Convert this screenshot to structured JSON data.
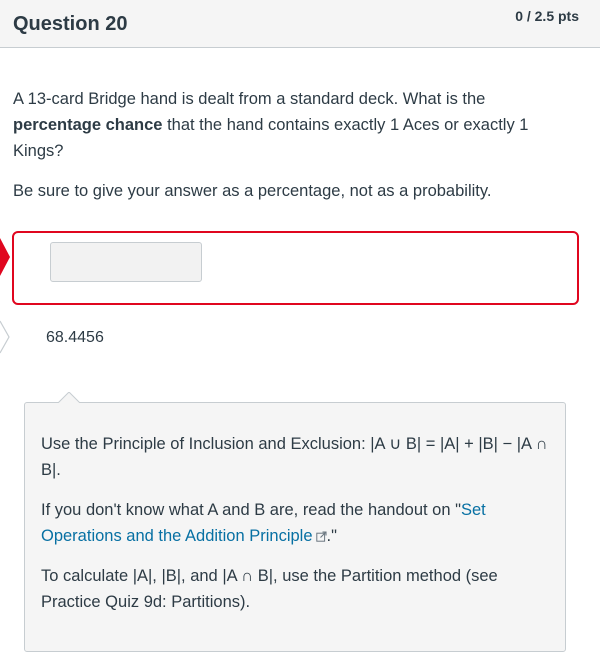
{
  "header": {
    "title": "Question 20",
    "points": "0 / 2.5 pts"
  },
  "question": {
    "line1_pre": "A 13-card Bridge hand is dealt from a standard deck. What is the ",
    "line1_bold": "percentage chance",
    "line1_post": " that the hand contains exactly 1 Aces or exactly 1 Kings?",
    "instruction": "Be sure to give your answer as a percentage, not as a probability."
  },
  "answer": {
    "value": "",
    "correct_answer": "68.4456"
  },
  "comment": {
    "para1": "Use the Principle of Inclusion and Exclusion: |A ∪ B| = |A| + |B| − |A ∩ B|.",
    "para2_pre": "If you don't know what A and B are, read the handout on \"",
    "para2_link": "Set Operations and the Addition Principle",
    "para2_post": ".\"",
    "para3": "To calculate |A|, |B|, and |A ∩ B|, use the Partition method (see Practice Quiz 9d: Partitions).",
    "link_icon": "external-link-icon"
  },
  "colors": {
    "wrong": "#e0061f",
    "link": "#0770a3",
    "text": "#2d3b45"
  }
}
